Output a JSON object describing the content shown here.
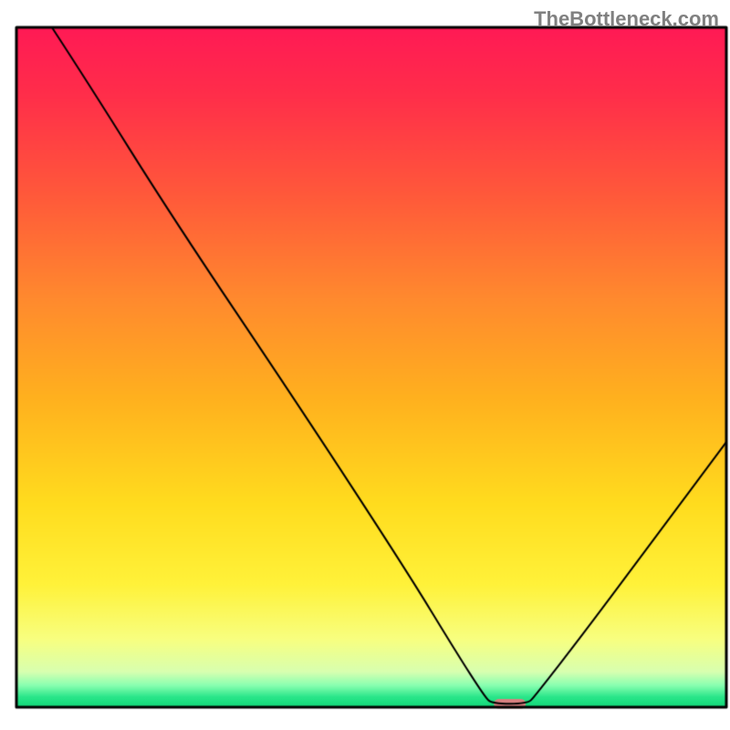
{
  "watermark": "TheBottleneck.com",
  "chart_data": {
    "type": "line",
    "title": "",
    "xlabel": "",
    "ylabel": "",
    "xlim": [
      0,
      100
    ],
    "ylim": [
      0,
      100
    ],
    "x": [
      0,
      22,
      67,
      72,
      100
    ],
    "y": [
      100,
      72,
      0,
      0,
      39
    ],
    "curve_points": [
      [
        5,
        100
      ],
      [
        10,
        92
      ],
      [
        22,
        72
      ],
      [
        40,
        44
      ],
      [
        55,
        20
      ],
      [
        62,
        8
      ],
      [
        66,
        1.5
      ],
      [
        67,
        0.5
      ],
      [
        72,
        0.5
      ],
      [
        73,
        1.6
      ],
      [
        80,
        11
      ],
      [
        90,
        25
      ],
      [
        100,
        39
      ]
    ],
    "marker": {
      "x": 69.5,
      "y": 0.5,
      "color": "#d88080",
      "width": 4.5,
      "height": 1.4
    },
    "background_gradient": [
      {
        "stop": 0.0,
        "color": "#ff1a55"
      },
      {
        "stop": 0.1,
        "color": "#ff2e4a"
      },
      {
        "stop": 0.25,
        "color": "#ff5a3a"
      },
      {
        "stop": 0.4,
        "color": "#ff8a2e"
      },
      {
        "stop": 0.55,
        "color": "#ffb21e"
      },
      {
        "stop": 0.7,
        "color": "#ffdc1e"
      },
      {
        "stop": 0.82,
        "color": "#fff23a"
      },
      {
        "stop": 0.9,
        "color": "#f8ff80"
      },
      {
        "stop": 0.948,
        "color": "#d8ffb0"
      },
      {
        "stop": 0.968,
        "color": "#88ffb0"
      },
      {
        "stop": 0.985,
        "color": "#2ae68a"
      },
      {
        "stop": 1.0,
        "color": "#10d878"
      }
    ],
    "border_color": "#000000",
    "line_color": "#000000",
    "line_width": 2
  }
}
